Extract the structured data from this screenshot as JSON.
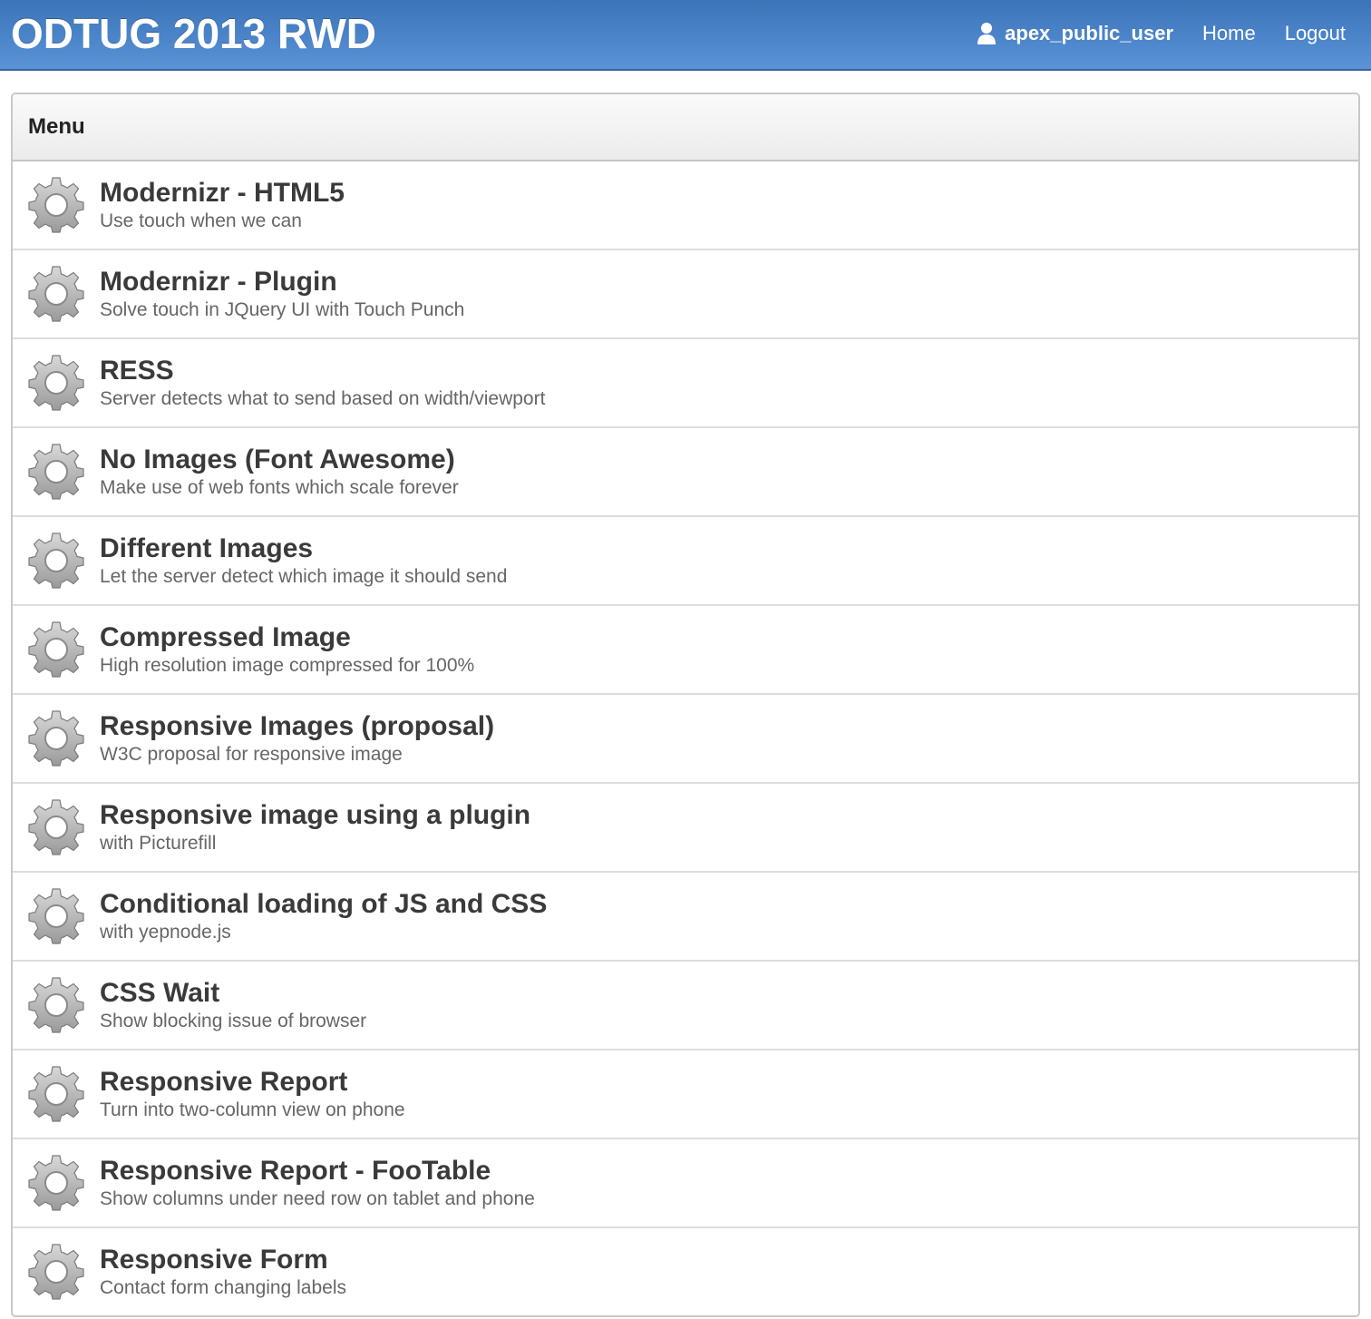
{
  "header": {
    "app_title": "ODTUG 2013 RWD",
    "user_name": "apex_public_user",
    "user_icon": "user-icon",
    "nav_links": [
      "Home",
      "Logout"
    ],
    "colors": {
      "header_bg": "#4a83c8",
      "header_text": "#ffffff"
    }
  },
  "menu": {
    "title": "Menu",
    "item_icon": "gear-icon",
    "items": [
      {
        "title": "Modernizr - HTML5",
        "desc": "Use touch when we can"
      },
      {
        "title": "Modernizr - Plugin",
        "desc": "Solve touch in JQuery UI with Touch Punch"
      },
      {
        "title": "RESS",
        "desc": "Server detects what to send based on width/viewport"
      },
      {
        "title": "No Images (Font Awesome)",
        "desc": "Make use of web fonts which scale forever"
      },
      {
        "title": "Different Images",
        "desc": "Let the server detect which image it should send"
      },
      {
        "title": "Compressed Image",
        "desc": "High resolution image compressed for 100%"
      },
      {
        "title": "Responsive Images (proposal)",
        "desc": "W3C proposal for responsive image"
      },
      {
        "title": "Responsive image using a plugin",
        "desc": "with Picturefill"
      },
      {
        "title": "Conditional loading of JS and CSS",
        "desc": "with yepnode.js"
      },
      {
        "title": "CSS Wait",
        "desc": "Show blocking issue of browser"
      },
      {
        "title": "Responsive Report",
        "desc": "Turn into two-column view on phone"
      },
      {
        "title": "Responsive Report - FooTable",
        "desc": "Show columns under need row on tablet and phone"
      },
      {
        "title": "Responsive Form",
        "desc": "Contact form changing labels"
      }
    ]
  }
}
